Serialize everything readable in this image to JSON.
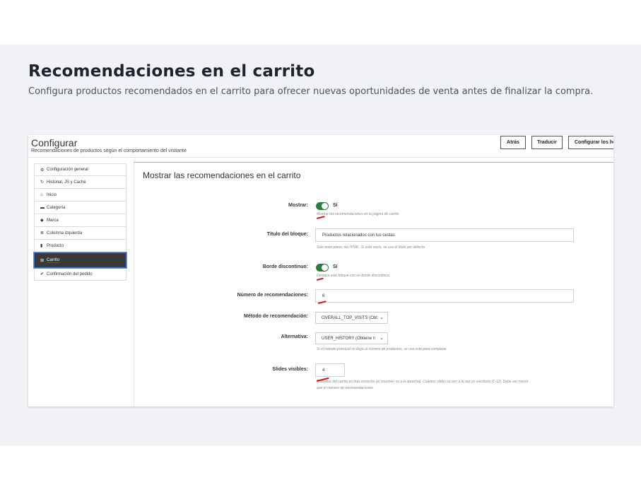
{
  "hero": {
    "title": "Recomendaciones en el carrito",
    "subtitle": "Configura productos recomendados en el carrito para ofrecer nuevas oportunidades de venta antes de finalizar la compra."
  },
  "panel": {
    "title": "Configurar",
    "subtitle": "Recomendaciones de productos según el comportamiento del visitante",
    "buttons": {
      "back": "Atrás",
      "translate": "Traducir",
      "configure_hooks": "Configurar los ho"
    }
  },
  "sidebar": {
    "items": [
      {
        "icon": "gears-icon",
        "glyph": "⚙",
        "label": "Configuración general"
      },
      {
        "icon": "refresh-icon",
        "glyph": "↻",
        "label": "Historial, JS y Cache"
      },
      {
        "icon": "home-icon",
        "glyph": "⌂",
        "label": "Inicio"
      },
      {
        "icon": "folder-icon",
        "glyph": "▬",
        "label": "Categoría"
      },
      {
        "icon": "tag-icon",
        "glyph": "◆",
        "label": "Marca"
      },
      {
        "icon": "columns-icon",
        "glyph": "≣",
        "label": "Columna izquierda"
      },
      {
        "icon": "book-icon",
        "glyph": "▮",
        "label": "Producto"
      },
      {
        "icon": "cart-icon",
        "glyph": "⊞",
        "label": "Carrito"
      },
      {
        "icon": "check-icon",
        "glyph": "✔",
        "label": "Confirmación del pedido"
      }
    ],
    "active_index": 7
  },
  "section": {
    "title": "Mostrar las recomendaciones en el carrito",
    "show": {
      "label": "Mostrar:",
      "value": "Sí",
      "enabled": true,
      "help": "Mostrar las recomendaciones en la página de carrito"
    },
    "block_title": {
      "label": "Título del bloque:",
      "value": "Productos relacionados con tus cestas",
      "help": "Solo texto plano, sin HTML. Si está vacío, se usa el título por defecto."
    },
    "dashed_border": {
      "label": "Borde discontinuo:",
      "value": "Sí",
      "enabled": true,
      "help": "Destaca este bloque con un borde discontinuo."
    },
    "num_recommendations": {
      "label": "Número de recomendaciones:",
      "value": "6"
    },
    "method": {
      "label": "Método de recomendación:",
      "value": "OVERALL_TOP_VISITS (Obt"
    },
    "fallback": {
      "label": "Alternativa:",
      "value": "USER_HISTORY (Obtiene n",
      "help": "Si el método principal no llega al número de productos, se usa este para completar"
    },
    "visible_slides": {
      "label": "Slides visibles:",
      "value": "4",
      "help_line1": "El bloque del carrito es más estrecho (el resumen va a la derecha). Cuántos slides se ven a la vez en escritorio (1-12). Debe ser menor",
      "help_line2": "que el número de recomendaciones."
    }
  },
  "colors": {
    "toggle_on": "#2d7a3e",
    "active_nav": "#3a3a3a",
    "annotation_marks": "#d01818",
    "band_bg": "#f0f2f5"
  }
}
